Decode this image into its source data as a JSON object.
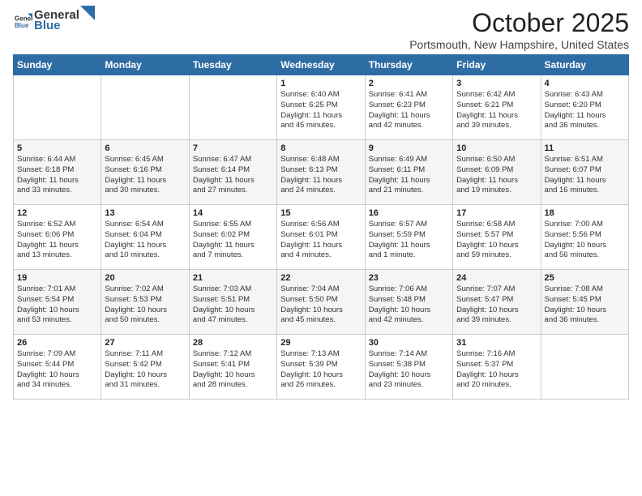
{
  "header": {
    "logo_general": "General",
    "logo_blue": "Blue",
    "month": "October 2025",
    "location": "Portsmouth, New Hampshire, United States"
  },
  "weekdays": [
    "Sunday",
    "Monday",
    "Tuesday",
    "Wednesday",
    "Thursday",
    "Friday",
    "Saturday"
  ],
  "weeks": [
    [
      {
        "day": "",
        "text": ""
      },
      {
        "day": "",
        "text": ""
      },
      {
        "day": "",
        "text": ""
      },
      {
        "day": "1",
        "text": "Sunrise: 6:40 AM\nSunset: 6:25 PM\nDaylight: 11 hours\nand 45 minutes."
      },
      {
        "day": "2",
        "text": "Sunrise: 6:41 AM\nSunset: 6:23 PM\nDaylight: 11 hours\nand 42 minutes."
      },
      {
        "day": "3",
        "text": "Sunrise: 6:42 AM\nSunset: 6:21 PM\nDaylight: 11 hours\nand 39 minutes."
      },
      {
        "day": "4",
        "text": "Sunrise: 6:43 AM\nSunset: 6:20 PM\nDaylight: 11 hours\nand 36 minutes."
      }
    ],
    [
      {
        "day": "5",
        "text": "Sunrise: 6:44 AM\nSunset: 6:18 PM\nDaylight: 11 hours\nand 33 minutes."
      },
      {
        "day": "6",
        "text": "Sunrise: 6:45 AM\nSunset: 6:16 PM\nDaylight: 11 hours\nand 30 minutes."
      },
      {
        "day": "7",
        "text": "Sunrise: 6:47 AM\nSunset: 6:14 PM\nDaylight: 11 hours\nand 27 minutes."
      },
      {
        "day": "8",
        "text": "Sunrise: 6:48 AM\nSunset: 6:13 PM\nDaylight: 11 hours\nand 24 minutes."
      },
      {
        "day": "9",
        "text": "Sunrise: 6:49 AM\nSunset: 6:11 PM\nDaylight: 11 hours\nand 21 minutes."
      },
      {
        "day": "10",
        "text": "Sunrise: 6:50 AM\nSunset: 6:09 PM\nDaylight: 11 hours\nand 19 minutes."
      },
      {
        "day": "11",
        "text": "Sunrise: 6:51 AM\nSunset: 6:07 PM\nDaylight: 11 hours\nand 16 minutes."
      }
    ],
    [
      {
        "day": "12",
        "text": "Sunrise: 6:52 AM\nSunset: 6:06 PM\nDaylight: 11 hours\nand 13 minutes."
      },
      {
        "day": "13",
        "text": "Sunrise: 6:54 AM\nSunset: 6:04 PM\nDaylight: 11 hours\nand 10 minutes."
      },
      {
        "day": "14",
        "text": "Sunrise: 6:55 AM\nSunset: 6:02 PM\nDaylight: 11 hours\nand 7 minutes."
      },
      {
        "day": "15",
        "text": "Sunrise: 6:56 AM\nSunset: 6:01 PM\nDaylight: 11 hours\nand 4 minutes."
      },
      {
        "day": "16",
        "text": "Sunrise: 6:57 AM\nSunset: 5:59 PM\nDaylight: 11 hours\nand 1 minute."
      },
      {
        "day": "17",
        "text": "Sunrise: 6:58 AM\nSunset: 5:57 PM\nDaylight: 10 hours\nand 59 minutes."
      },
      {
        "day": "18",
        "text": "Sunrise: 7:00 AM\nSunset: 5:56 PM\nDaylight: 10 hours\nand 56 minutes."
      }
    ],
    [
      {
        "day": "19",
        "text": "Sunrise: 7:01 AM\nSunset: 5:54 PM\nDaylight: 10 hours\nand 53 minutes."
      },
      {
        "day": "20",
        "text": "Sunrise: 7:02 AM\nSunset: 5:53 PM\nDaylight: 10 hours\nand 50 minutes."
      },
      {
        "day": "21",
        "text": "Sunrise: 7:03 AM\nSunset: 5:51 PM\nDaylight: 10 hours\nand 47 minutes."
      },
      {
        "day": "22",
        "text": "Sunrise: 7:04 AM\nSunset: 5:50 PM\nDaylight: 10 hours\nand 45 minutes."
      },
      {
        "day": "23",
        "text": "Sunrise: 7:06 AM\nSunset: 5:48 PM\nDaylight: 10 hours\nand 42 minutes."
      },
      {
        "day": "24",
        "text": "Sunrise: 7:07 AM\nSunset: 5:47 PM\nDaylight: 10 hours\nand 39 minutes."
      },
      {
        "day": "25",
        "text": "Sunrise: 7:08 AM\nSunset: 5:45 PM\nDaylight: 10 hours\nand 36 minutes."
      }
    ],
    [
      {
        "day": "26",
        "text": "Sunrise: 7:09 AM\nSunset: 5:44 PM\nDaylight: 10 hours\nand 34 minutes."
      },
      {
        "day": "27",
        "text": "Sunrise: 7:11 AM\nSunset: 5:42 PM\nDaylight: 10 hours\nand 31 minutes."
      },
      {
        "day": "28",
        "text": "Sunrise: 7:12 AM\nSunset: 5:41 PM\nDaylight: 10 hours\nand 28 minutes."
      },
      {
        "day": "29",
        "text": "Sunrise: 7:13 AM\nSunset: 5:39 PM\nDaylight: 10 hours\nand 26 minutes."
      },
      {
        "day": "30",
        "text": "Sunrise: 7:14 AM\nSunset: 5:38 PM\nDaylight: 10 hours\nand 23 minutes."
      },
      {
        "day": "31",
        "text": "Sunrise: 7:16 AM\nSunset: 5:37 PM\nDaylight: 10 hours\nand 20 minutes."
      },
      {
        "day": "",
        "text": ""
      }
    ]
  ]
}
